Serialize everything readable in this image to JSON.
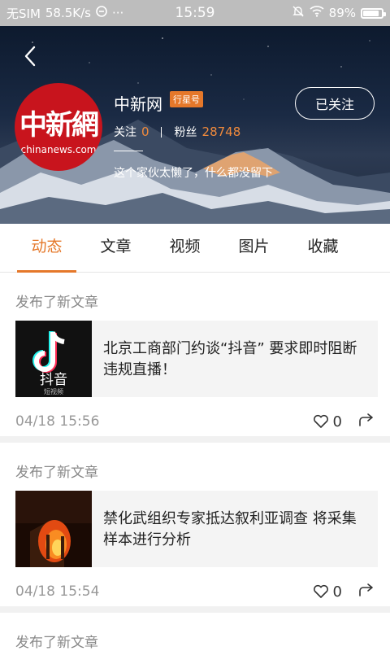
{
  "status_bar": {
    "carrier": "无SIM",
    "speed": "58.5K/s",
    "time": "15:59",
    "battery_pct": "89%"
  },
  "profile": {
    "name": "中新网",
    "badge": "行星号",
    "avatar_text_cn": "中新網",
    "avatar_text_en": "chinanews.com",
    "following_label": "关注",
    "following_count": "0",
    "fans_label": "粉丝",
    "fans_count": "28748",
    "bio": "这个家伙太懒了，什么都没留下",
    "follow_button": "已关注"
  },
  "tabs": [
    {
      "label": "动态",
      "active": true
    },
    {
      "label": "文章",
      "active": false
    },
    {
      "label": "视频",
      "active": false
    },
    {
      "label": "图片",
      "active": false
    },
    {
      "label": "收藏",
      "active": false
    }
  ],
  "feed": [
    {
      "action": "发布了新文章",
      "title": "北京工商部门约谈“抖音” 要求即时阻断违规直播！",
      "thumb_text": "抖音",
      "thumb_sub": "短视频",
      "time": "04/18 15:56",
      "likes": "0"
    },
    {
      "action": "发布了新文章",
      "title": "禁化武组织专家抵达叙利亚调查 将采集样本进行分析",
      "time": "04/18 15:54",
      "likes": "0"
    },
    {
      "action": "发布了新文章"
    }
  ],
  "colors": {
    "accent": "#e5782a",
    "avatar_red": "#c8141d"
  }
}
